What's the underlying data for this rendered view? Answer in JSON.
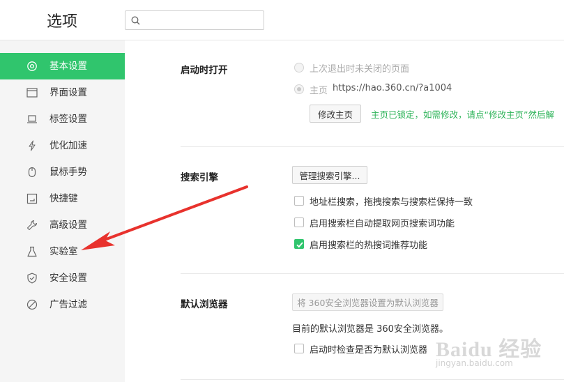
{
  "header": {
    "title": "选项",
    "search": {
      "value": "",
      "placeholder": ""
    }
  },
  "sidebar": {
    "items": [
      {
        "label": "基本设置",
        "icon": "gear-icon",
        "active": true
      },
      {
        "label": "界面设置",
        "icon": "window-icon",
        "active": false
      },
      {
        "label": "标签设置",
        "icon": "tab-icon",
        "active": false
      },
      {
        "label": "优化加速",
        "icon": "lightning-icon",
        "active": false
      },
      {
        "label": "鼠标手势",
        "icon": "mouse-icon",
        "active": false
      },
      {
        "label": "快捷键",
        "icon": "keyboard-icon",
        "active": false
      },
      {
        "label": "高级设置",
        "icon": "wrench-icon",
        "active": false
      },
      {
        "label": "实验室",
        "icon": "flask-icon",
        "active": false
      },
      {
        "label": "安全设置",
        "icon": "shield-icon",
        "active": false
      },
      {
        "label": "广告过滤",
        "icon": "block-icon",
        "active": false
      }
    ]
  },
  "startup": {
    "title": "启动时打开",
    "option1": "上次退出时未关闭的页面",
    "option2_label": "主页",
    "option2_url": "https://hao.360.cn/?a1004",
    "edit_button": "修改主页",
    "locked_note": "主页已锁定，如需修改，请点“修改主页”然后解"
  },
  "search_engine": {
    "title": "搜索引擎",
    "manage_button": "管理搜索引擎...",
    "options": [
      {
        "label": "地址栏搜索，拖拽搜索与搜索栏保持一致",
        "checked": false
      },
      {
        "label": "启用搜索栏自动提取网页搜索词功能",
        "checked": false
      },
      {
        "label": "启用搜索栏的热搜词推荐功能",
        "checked": true
      }
    ]
  },
  "default_browser": {
    "title": "默认浏览器",
    "set_button": "将 360安全浏览器设置为默认浏览器",
    "status": "目前的默认浏览器是 360安全浏览器。",
    "check_option": "启动时检查是否为默认浏览器"
  },
  "watermark": {
    "text": "Baidu 经验",
    "sub": "jingyan.baidu.com"
  },
  "colors": {
    "accent": "#30c56d",
    "arrow": "#e8322d",
    "note": "#2fb45a"
  }
}
